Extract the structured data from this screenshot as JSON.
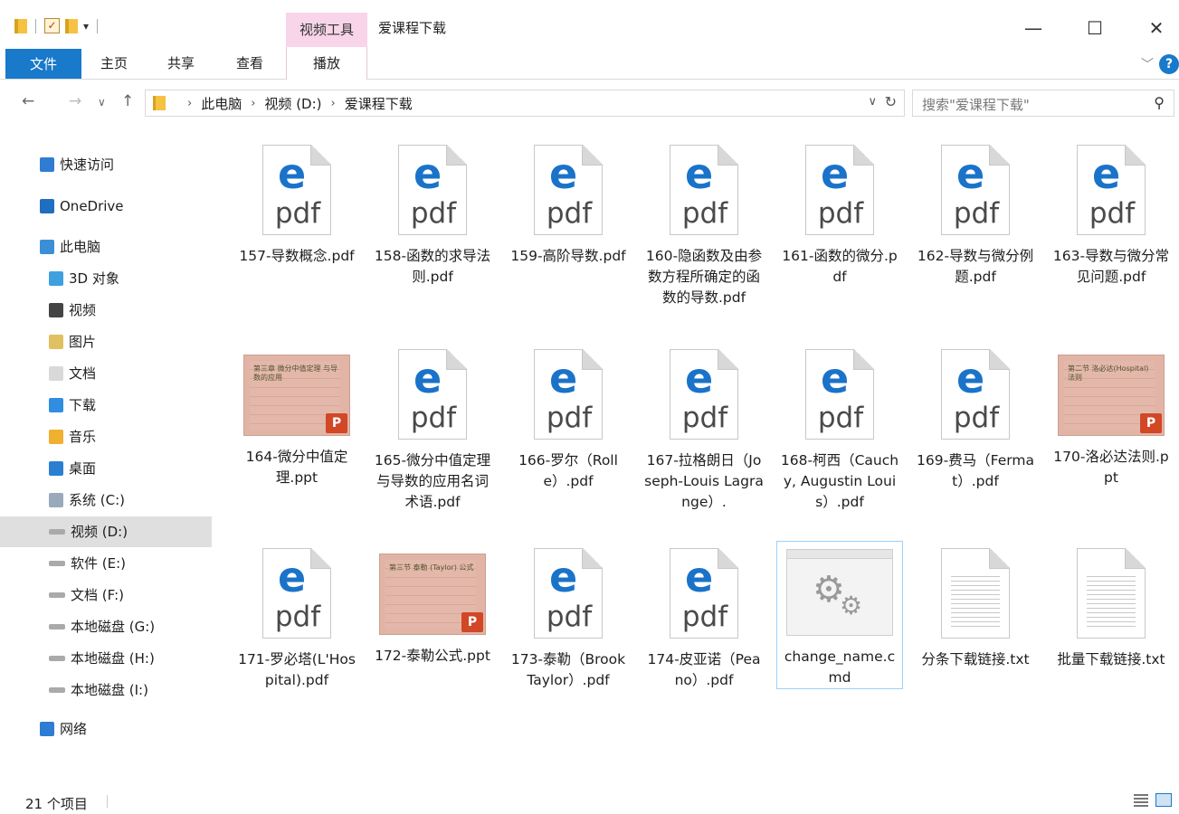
{
  "window": {
    "context_tab": "视频工具",
    "title": "爱课程下载",
    "minimize": "—",
    "maximize": "☐",
    "close": "✕"
  },
  "ribbon": {
    "tabs": [
      "文件",
      "主页",
      "共享",
      "查看",
      "播放"
    ],
    "help": "?"
  },
  "address": {
    "crumbs": [
      "此电脑",
      "视频 (D:)",
      "爱课程下载"
    ]
  },
  "search": {
    "placeholder": "搜索\"爱课程下载\""
  },
  "nav": [
    {
      "label": "快速访问",
      "icon": "star-icon"
    },
    {
      "label": "OneDrive",
      "icon": "cloud-icon"
    },
    {
      "label": "此电脑",
      "icon": "computer-icon"
    },
    {
      "label": "3D 对象",
      "icon": "3d-objects-icon"
    },
    {
      "label": "视频",
      "icon": "video-folder-icon"
    },
    {
      "label": "图片",
      "icon": "pictures-folder-icon"
    },
    {
      "label": "文档",
      "icon": "documents-folder-icon"
    },
    {
      "label": "下载",
      "icon": "downloads-folder-icon"
    },
    {
      "label": "音乐",
      "icon": "music-folder-icon"
    },
    {
      "label": "桌面",
      "icon": "desktop-folder-icon"
    },
    {
      "label": "系统 (C:)",
      "icon": "system-drive-icon"
    },
    {
      "label": "视频 (D:)",
      "icon": "drive-icon"
    },
    {
      "label": "软件 (E:)",
      "icon": "drive-icon"
    },
    {
      "label": "文档 (F:)",
      "icon": "drive-icon"
    },
    {
      "label": "本地磁盘 (G:)",
      "icon": "drive-icon"
    },
    {
      "label": "本地磁盘 (H:)",
      "icon": "drive-icon"
    },
    {
      "label": "本地磁盘 (I:)",
      "icon": "drive-icon"
    },
    {
      "label": "网络",
      "icon": "network-icon"
    }
  ],
  "files": [
    {
      "name": "157-导数概念.pdf",
      "type": "pdf"
    },
    {
      "name": "158-函数的求导法则.pdf",
      "type": "pdf"
    },
    {
      "name": "159-高阶导数.pdf",
      "type": "pdf"
    },
    {
      "name": "160-隐函数及由参数方程所确定的函数的导数.pdf",
      "type": "pdf"
    },
    {
      "name": "161-函数的微分.pdf",
      "type": "pdf"
    },
    {
      "name": "162-导数与微分例题.pdf",
      "type": "pdf"
    },
    {
      "name": "163-导数与微分常见问题.pdf",
      "type": "pdf"
    },
    {
      "name": "164-微分中值定理.ppt",
      "type": "ppt",
      "thumb": "第三章 微分中值定理 与导数的应用"
    },
    {
      "name": "165-微分中值定理与导数的应用名词术语.pdf",
      "type": "pdf"
    },
    {
      "name": "166-罗尔（Rolle）.pdf",
      "type": "pdf"
    },
    {
      "name": "167-拉格朗日（Joseph-Louis Lagrange）.",
      "type": "pdf"
    },
    {
      "name": "168-柯西（Cauchy, Augustin Louis）.pdf",
      "type": "pdf"
    },
    {
      "name": "169-费马（Fermat）.pdf",
      "type": "pdf"
    },
    {
      "name": "170-洛必达法则.ppt",
      "type": "ppt",
      "thumb": "第二节 洛必达(Hospital)法则"
    },
    {
      "name": "171-罗必塔(L'Hospital).pdf",
      "type": "pdf"
    },
    {
      "name": "172-泰勒公式.ppt",
      "type": "ppt",
      "thumb": "第三节 泰勒 (Taylor) 公式"
    },
    {
      "name": "173-泰勒（Brook Taylor）.pdf",
      "type": "pdf"
    },
    {
      "name": "174-皮亚诺（Peano）.pdf",
      "type": "pdf"
    },
    {
      "name": "change_name.cmd",
      "type": "cmd"
    },
    {
      "name": "分条下载链接.txt",
      "type": "txt"
    },
    {
      "name": "批量下载链接.txt",
      "type": "txt"
    }
  ],
  "labels": {
    "pdf_letter": "e",
    "pdf_text": "pdf",
    "ppt_badge": "P"
  },
  "status": {
    "count": "21 个项目"
  }
}
